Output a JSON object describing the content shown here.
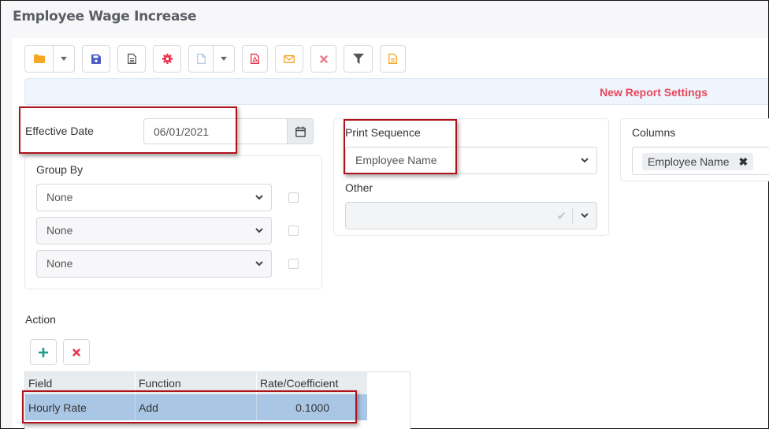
{
  "page": {
    "title": "Employee Wage Increase"
  },
  "toolbar": {
    "buttons": [
      {
        "icon": "folder-icon",
        "color": "#f5a623"
      },
      {
        "icon": "save-icon",
        "color": "#4a5bc4"
      },
      {
        "icon": "document-icon",
        "color": "#555555"
      },
      {
        "icon": "gear-icon",
        "color": "#e8334a"
      },
      {
        "icon": "new-file-icon",
        "color": "#a9c4e8"
      },
      {
        "icon": "pdf-icon",
        "color": "#e8334a"
      },
      {
        "icon": "email-icon",
        "color": "#f5a623"
      },
      {
        "icon": "close-icon",
        "color": "#e9798a"
      },
      {
        "icon": "filter-icon",
        "color": "#555555"
      },
      {
        "icon": "report-icon",
        "color": "#f5a623"
      }
    ]
  },
  "report_bar": {
    "title": "New Report Settings",
    "color": "#e8475a"
  },
  "effective_date": {
    "label": "Effective Date",
    "value": "06/01/2021"
  },
  "group_by": {
    "label": "Group By",
    "rows": [
      {
        "value": "None",
        "checked": false
      },
      {
        "value": "None",
        "checked": false
      },
      {
        "value": "None",
        "checked": false
      }
    ]
  },
  "print_sequence": {
    "label": "Print Sequence",
    "value": "Employee Name"
  },
  "other": {
    "label": "Other",
    "value": ""
  },
  "columns": {
    "label": "Columns",
    "tags": [
      "Employee Name"
    ],
    "remove_glyph": "✖"
  },
  "action": {
    "label": "Action",
    "add_glyph": "+",
    "delete_glyph": "✖",
    "table": {
      "headers": [
        "Field",
        "Function",
        "Rate/Coefficient"
      ],
      "rows": [
        [
          "Hourly Rate",
          "Add",
          "0.1000"
        ]
      ]
    }
  },
  "highlight_color": "#b0121b",
  "selected_row_color": "#aac6e5"
}
